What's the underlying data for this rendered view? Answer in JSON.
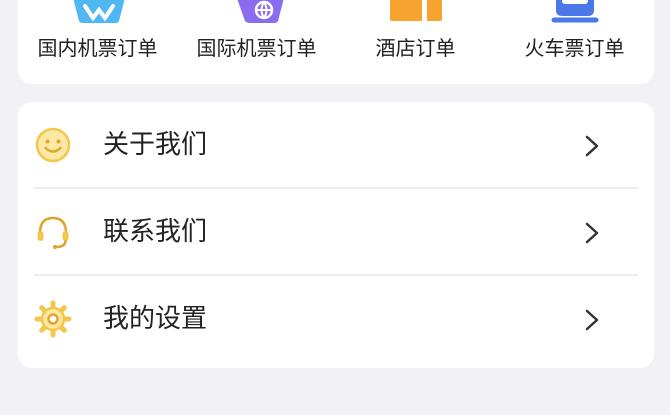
{
  "orders": {
    "items": [
      {
        "label": "国内机票订单",
        "icon": "domestic-flight-icon"
      },
      {
        "label": "国际机票订单",
        "icon": "international-flight-icon"
      },
      {
        "label": "酒店订单",
        "icon": "hotel-icon"
      },
      {
        "label": "火车票订单",
        "icon": "train-icon"
      }
    ]
  },
  "menu": {
    "items": [
      {
        "label": "关于我们",
        "icon": "smiley-icon"
      },
      {
        "label": "联系我们",
        "icon": "headset-icon"
      },
      {
        "label": "我的设置",
        "icon": "gear-icon"
      }
    ],
    "chevron_icon": "chevron-right-icon"
  },
  "colors": {
    "background": "#f2f2f6",
    "card": "#ffffff",
    "accent_yellow": "#f3c74a",
    "flight_blue": "#4fb8f2",
    "international_purple": "#8b6cf0",
    "hotel_orange": "#f7a330",
    "train_blue": "#4a78e8"
  }
}
